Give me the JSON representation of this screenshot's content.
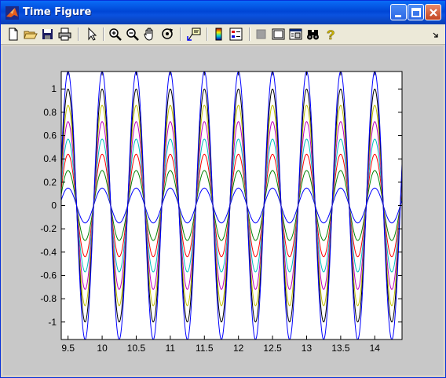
{
  "window": {
    "title": "Time Figure"
  },
  "toolbar": {
    "icons": [
      "new-figure-icon",
      "open-file-icon",
      "save-icon",
      "print-icon",
      "edit-plot-arrow-icon",
      "zoom-in-icon",
      "zoom-out-icon",
      "pan-hand-icon",
      "rotate-3d-icon",
      "data-cursor-icon",
      "colorbar-icon",
      "legend-icon",
      "hide-plot-tools-icon",
      "show-plot-tools-icon",
      "plot-browser-icon",
      "binoculars-icon",
      "help-icon"
    ]
  },
  "chart_data": {
    "type": "line",
    "title": "",
    "xlabel": "",
    "ylabel": "",
    "xlim": [
      9.4,
      14.4
    ],
    "ylim": [
      -1.15,
      1.15
    ],
    "xticks": [
      9.5,
      10,
      10.5,
      11,
      11.5,
      12,
      12.5,
      13,
      13.5,
      14
    ],
    "yticks": [
      -1,
      -0.8,
      -0.6,
      -0.4,
      -0.2,
      0,
      0.2,
      0.4,
      0.6,
      0.8,
      1
    ],
    "xtick_labels": [
      "9.5",
      "10",
      "10.5",
      "11",
      "11.5",
      "12",
      "12.5",
      "13",
      "13.5",
      "14"
    ],
    "ytick_labels": [
      "-1",
      "-0.8",
      "-0.6",
      "-0.4",
      "-0.2",
      "0",
      "0.2",
      "0.4",
      "0.6",
      "0.8",
      "1"
    ],
    "period": 0.5,
    "peak_x": 9.5,
    "grid": false,
    "series": [
      {
        "amplitude": 0.15,
        "color": "#0000ff"
      },
      {
        "amplitude": 0.3,
        "color": "#008000"
      },
      {
        "amplitude": 0.44,
        "color": "#ff0000"
      },
      {
        "amplitude": 0.57,
        "color": "#00bfbf"
      },
      {
        "amplitude": 0.72,
        "color": "#bf00bf"
      },
      {
        "amplitude": 0.86,
        "color": "#bfbf00"
      },
      {
        "amplitude": 1.0,
        "color": "#000000"
      },
      {
        "amplitude": 1.15,
        "color": "#0000ff"
      }
    ]
  }
}
